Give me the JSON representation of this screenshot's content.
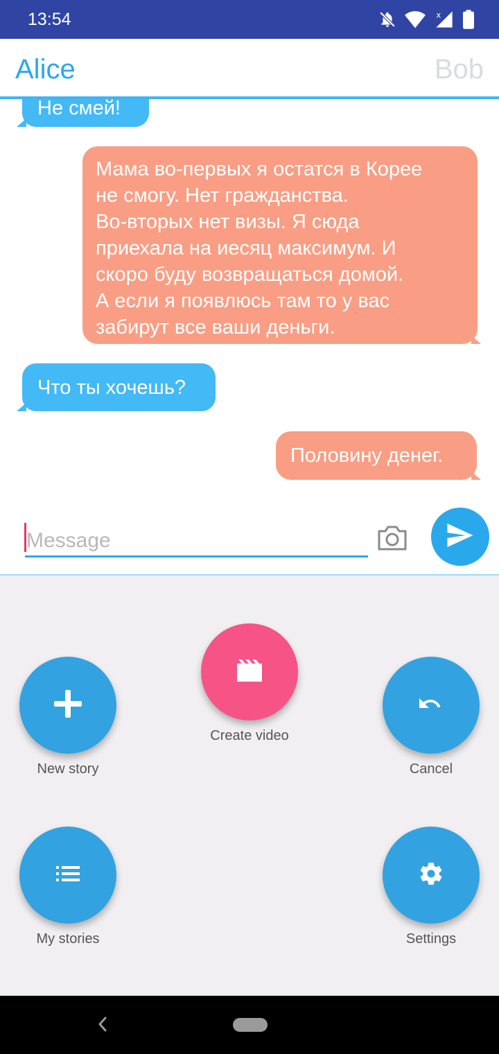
{
  "status_bar": {
    "time": "13:54"
  },
  "header": {
    "left_name": "Alice",
    "right_name": "Bob"
  },
  "messages": [
    {
      "side": "in",
      "text": "Не смей!"
    },
    {
      "side": "out",
      "lines": [
        "Мама во-первых я остатся в Корее",
        "не смогу. Нет гражданства.",
        "Во-вторых нет визы. Я сюда",
        "приехала на иесяц максимум. И",
        "скоро буду возвращаться домой.",
        "А если я появлюсь там то у вас",
        "забирут все ваши деньги."
      ]
    },
    {
      "side": "in",
      "text": "Что ты хочешь?"
    },
    {
      "side": "out",
      "text": "Половину денег."
    }
  ],
  "composer": {
    "placeholder": "Message"
  },
  "actions": {
    "new_story": "New story",
    "create_video": "Create video",
    "cancel": "Cancel",
    "my_stories": "My stories",
    "settings": "Settings"
  },
  "colors": {
    "status_bar": "#2f44a3",
    "accent": "#2aa8ec",
    "incoming_bubble": "#43b9f6",
    "outgoing_bubble": "#f99e84",
    "fab_blue": "#33a2e0",
    "fab_pink": "#f65387",
    "panel_bg": "#f1eff2"
  },
  "icons": {
    "status": [
      "do-not-disturb-icon",
      "wifi-icon",
      "signal-icon",
      "battery-icon"
    ],
    "composer": [
      "camera-icon",
      "send-icon"
    ],
    "actions": [
      "plus-icon",
      "clapperboard-icon",
      "undo-icon",
      "list-icon",
      "gear-icon"
    ],
    "nav": [
      "back-icon",
      "home-pill-icon"
    ]
  }
}
